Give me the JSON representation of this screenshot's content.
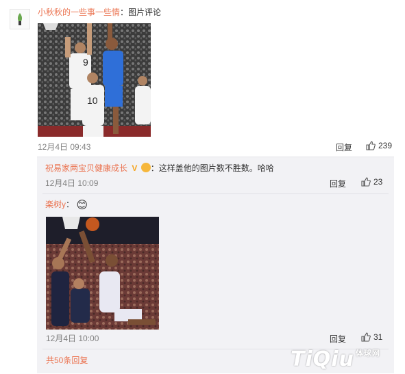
{
  "comment": {
    "author": "小秋秋的一些事一些情",
    "label": "：图片评论",
    "time": "12月4日 09:43",
    "reply_label": "回复",
    "like_count": "239"
  },
  "replies": [
    {
      "author": "祝易家两宝贝健康成长",
      "badge": "V",
      "text": "：这样盖他的图片数不胜数。哈哈",
      "time": "12月4日 10:09",
      "reply_label": "回复",
      "like_count": "23"
    },
    {
      "author": "楽树y",
      "text": "：",
      "emoji": "😊",
      "time": "12月4日 10:00",
      "reply_label": "回复",
      "like_count": "31"
    }
  ],
  "more_replies": "共50条回复",
  "watermark": {
    "brand": "TiQiu",
    "sub": "体球网"
  },
  "colors": {
    "username": "#eb7350",
    "reply_bg": "#f2f2f5",
    "badge": "#f5a623"
  }
}
